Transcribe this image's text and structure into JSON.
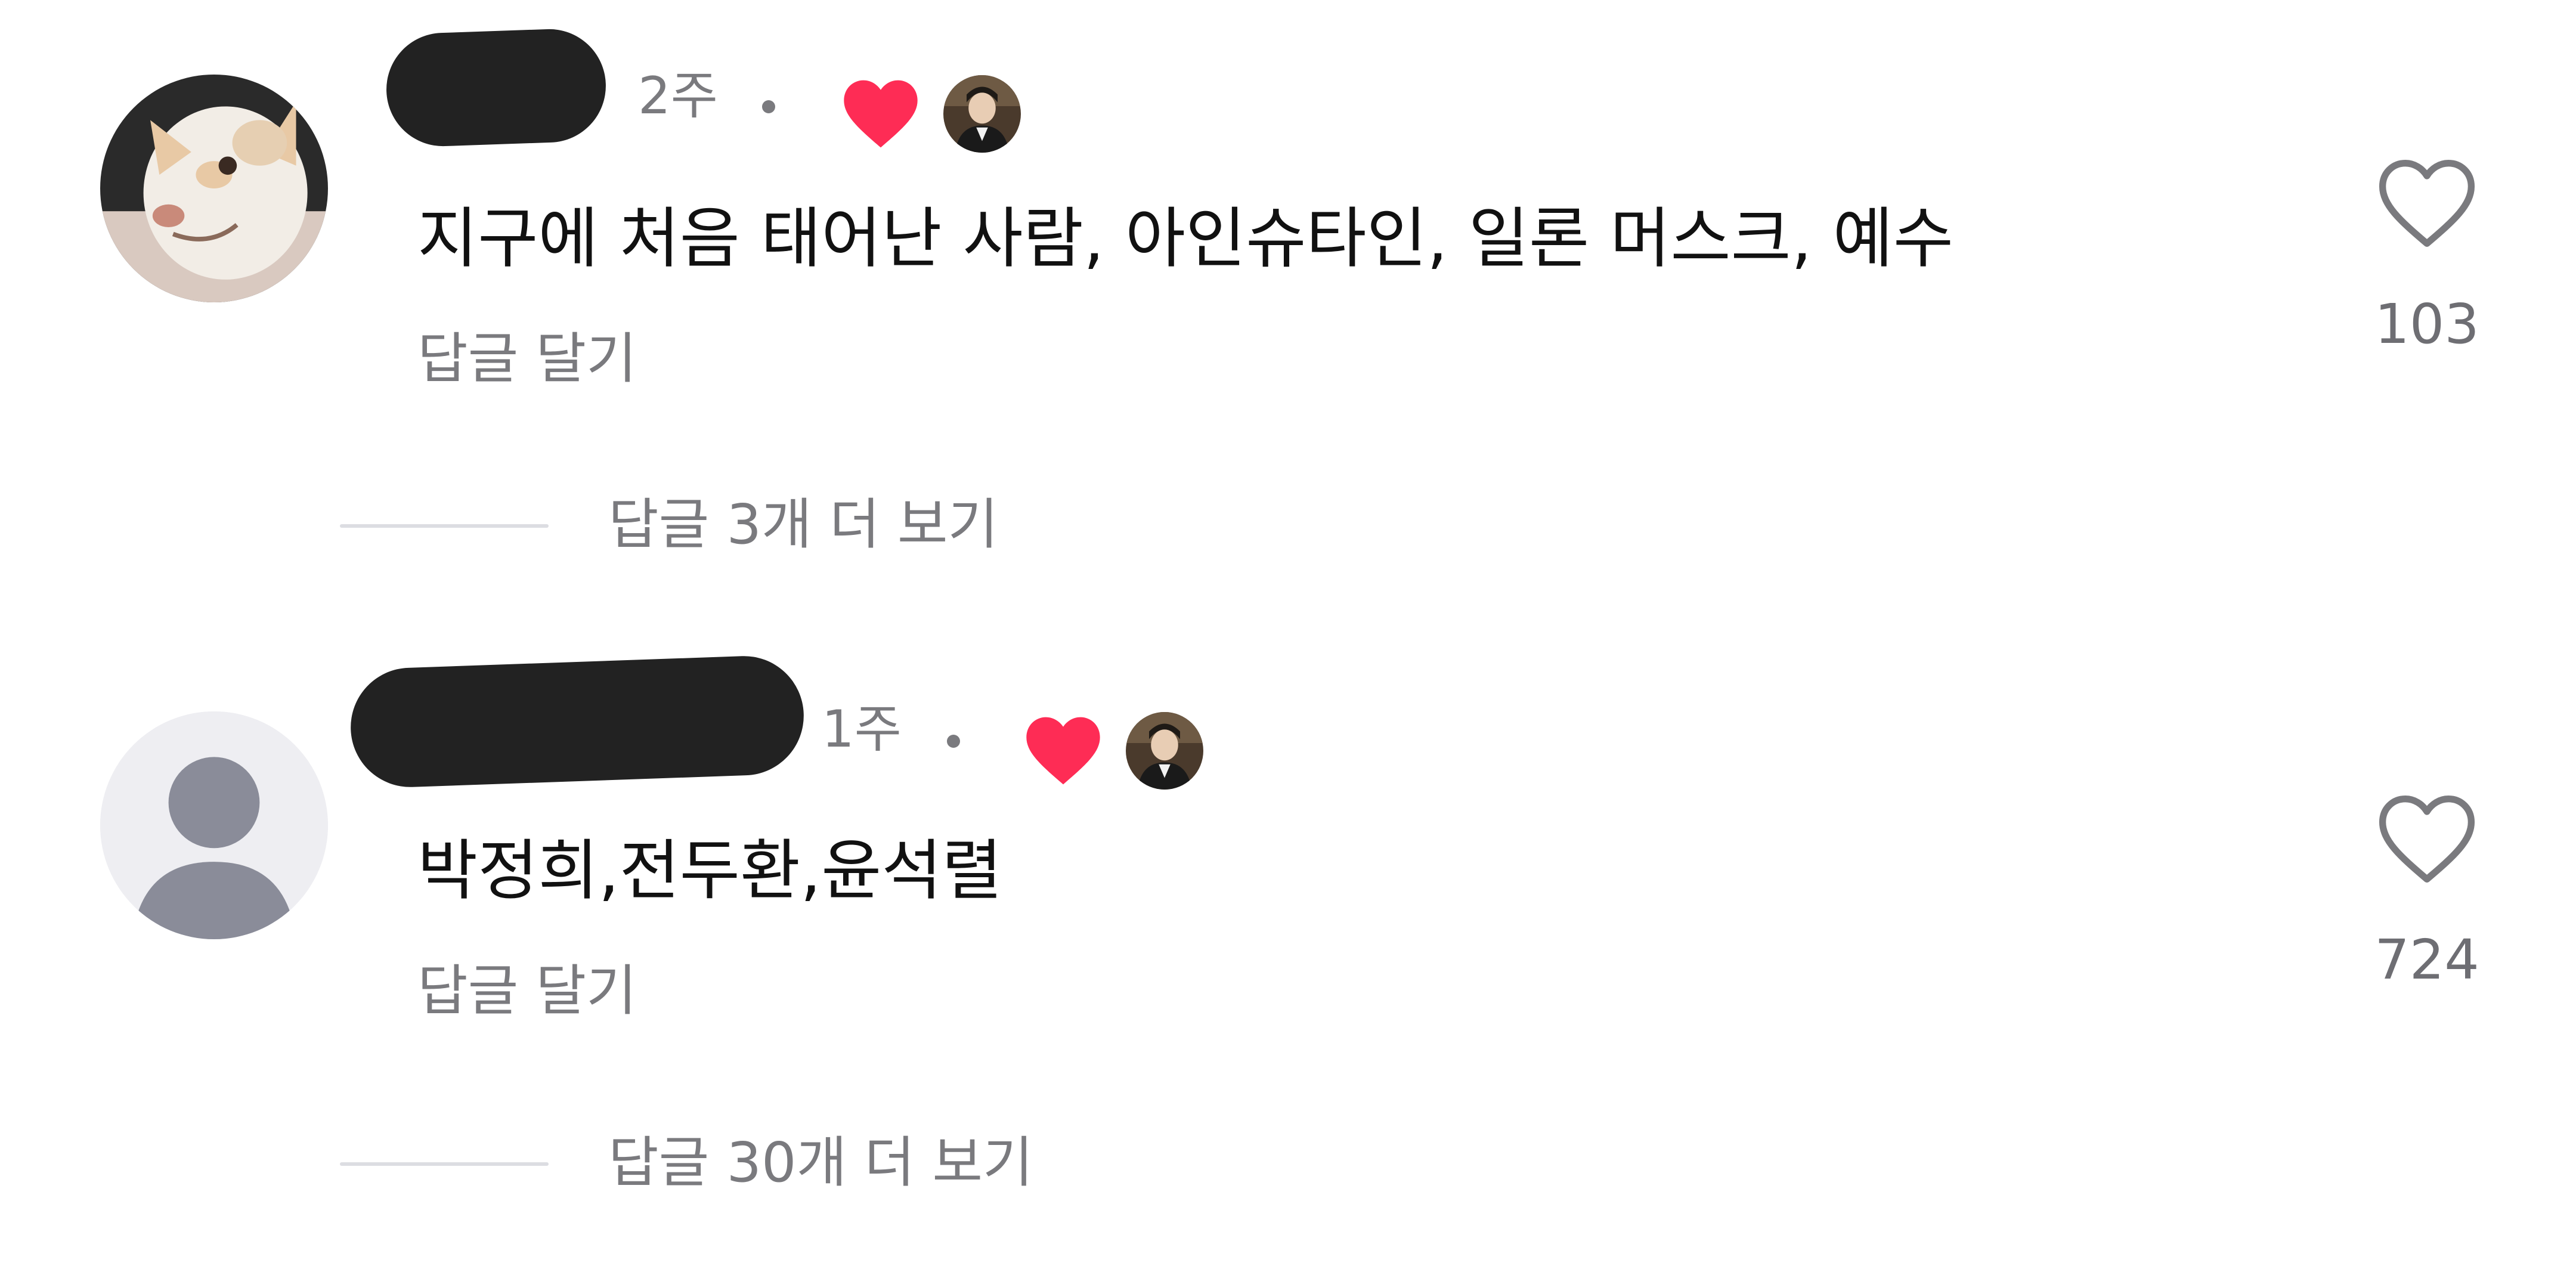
{
  "comments": [
    {
      "time": "2주",
      "text": "지구에 처음 태어난 사람, 아인슈타인, 일론 머스크, 예수",
      "reply_label": "답글 달기",
      "likes": "103",
      "more_replies": "답글 3개 더 보기",
      "avatar_icon": "dog-photo-avatar",
      "liked_by_creator": true
    },
    {
      "time": "1주",
      "text": "박정희,전두환,윤석렬",
      "reply_label": "답글 달기",
      "likes": "724",
      "more_replies": "답글 30개 더 보기",
      "avatar_icon": "default-person-avatar",
      "liked_by_creator": true
    }
  ],
  "colors": {
    "heart_red": "#fe2c55",
    "muted_text": "#7a7a7e",
    "redaction": "#222222",
    "divider": "#dcdde2",
    "default_avatar_bg": "#eeeef2",
    "default_avatar_fg": "#8a8c99"
  }
}
